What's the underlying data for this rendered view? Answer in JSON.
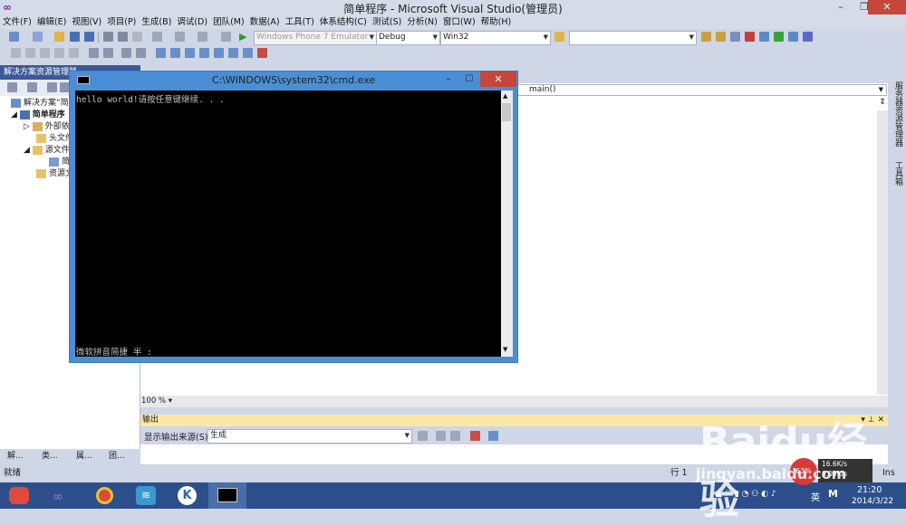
{
  "window": {
    "title": "简单程序 - Microsoft Visual Studio(管理员)"
  },
  "menu": [
    "文件(F)",
    "编辑(E)",
    "视图(V)",
    "项目(P)",
    "生成(B)",
    "调试(D)",
    "团队(M)",
    "数据(A)",
    "工具(T)",
    "体系结构(C)",
    "测试(S)",
    "分析(N)",
    "窗口(W)",
    "帮助(H)"
  ],
  "toolbar": {
    "target_device": "Windows Phone 7 Emulator",
    "configuration": "Debug",
    "platform": "Win32",
    "search_value": ""
  },
  "solution_explorer": {
    "title": "解决方案资源管理器",
    "items": [
      {
        "label": "解决方案“简"
      },
      {
        "label": "简单程序"
      },
      {
        "label": "外部依"
      },
      {
        "label": "头文件"
      },
      {
        "label": "源文件"
      },
      {
        "label": "简"
      },
      {
        "label": "资源文"
      }
    ],
    "tabs": [
      "解...",
      "类...",
      "属...",
      "团..."
    ]
  },
  "editor": {
    "function_nav": "main()",
    "zoom": "100 %"
  },
  "right_tabs": [
    "服务器资源管理器",
    "工具箱"
  ],
  "output": {
    "title": "输出",
    "source_label": "显示输出来源(S):",
    "source_value": "生成"
  },
  "statusbar": {
    "left": "就绪",
    "line": "行 1",
    "ins": "Ins"
  },
  "cmd": {
    "title": "C:\\WINDOWS\\system32\\cmd.exe",
    "line1": "hello world!请按任意键继续. . .",
    "ime": "微软拼音简捷 半 :"
  },
  "tray": {
    "time": "21:20",
    "date": "2014/3/22",
    "lang": "英",
    "net_speed": "16.6K/s",
    "net_speed2": "0.09K/s",
    "cpu": "63%"
  },
  "watermark": {
    "brand": "Baidu经验",
    "url": "jingyan.baidu.com"
  }
}
